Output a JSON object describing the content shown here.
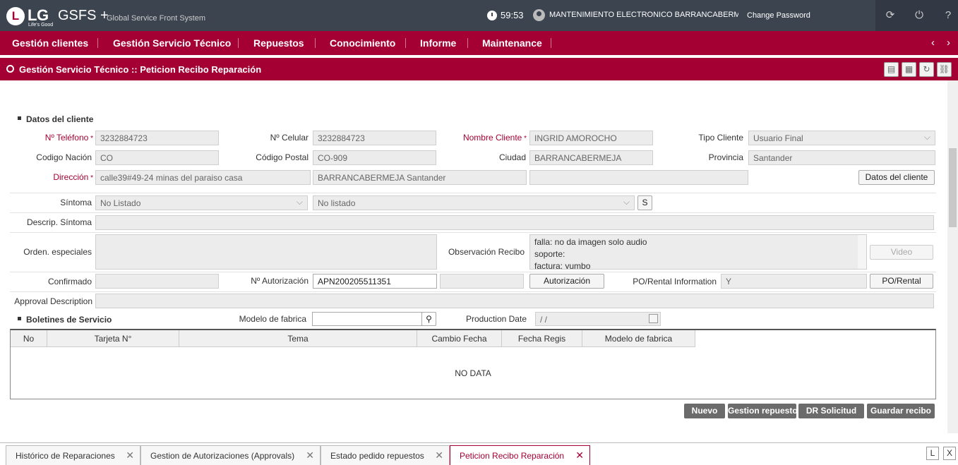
{
  "header": {
    "logo_letters": "LG",
    "logo_text": "LG",
    "logo_tagline": "Life's Good",
    "app_name": "GSFS +",
    "app_subtitle": "Global Service Front System",
    "timer": "59:53",
    "user": "MANTENIMIENTO ELECTRONICO BARRANCABERMEJA",
    "change_password": "Change Password",
    "icons": [
      "refresh-icon",
      "power-icon",
      "help-icon"
    ]
  },
  "menu": {
    "items": [
      "Gestión clientes",
      "Gestión Servicio Técnico",
      "Repuestos",
      "Conocimiento",
      "Informe",
      "Maintenance"
    ]
  },
  "page": {
    "title": "Gestión Servicio Técnico :: Peticion Recibo Reparación",
    "title_icons": [
      "print-icon",
      "excel-icon",
      "reload-icon",
      "link-icon"
    ]
  },
  "cliente": {
    "section_title": "Datos del cliente",
    "telefono_label": "Nº Teléfono",
    "telefono": "3232884723",
    "celular_label": "Nº Celular",
    "celular": "3232884723",
    "nombre_label": "Nombre Cliente",
    "nombre": "INGRID AMOROCHO",
    "tipo_label": "Tipo Cliente",
    "tipo": "Usuario Final",
    "nacion_label": "Codigo Nación",
    "nacion": "CO",
    "postal_label": "Código Postal",
    "postal": "CO-909",
    "ciudad_label": "Ciudad",
    "ciudad": "BARRANCABERMEJA",
    "provincia_label": "Provincia",
    "provincia": "Santander",
    "direccion_label": "Dirección",
    "direccion": "calle39#49-24 minas del paraiso casa",
    "direccion2": "BARRANCABERMEJA  Santander",
    "datos_button": "Datos del cliente"
  },
  "sintoma": {
    "label": "Síntoma",
    "value1": "No Listado",
    "value2": "No listado",
    "s_button": "S",
    "descrip_label": "Descrip. Síntoma",
    "orden_label": "Orden. especiales",
    "obs_label": "Observación Recibo",
    "obs_lines": [
      "falla:  no da imagen solo audio",
      "soporte:",
      "factura: yumbo"
    ],
    "video_button": "Video"
  },
  "autorizacion": {
    "confirmado_label": "Confirmado",
    "aut_label": "Nº Autorización",
    "aut_value": "APN200205511351",
    "aut_button": "Autorización",
    "po_label": "PO/Rental Information",
    "po_value": "Y",
    "po_button": "PO/Rental",
    "approval_label": "Approval Description"
  },
  "boletines": {
    "section_title": "Boletines de Servicio",
    "modelo_label": "Modelo de fabrica",
    "prod_label": "Production Date",
    "prod_value": " /  /",
    "columns": [
      "No",
      "Tarjeta N°",
      "Tema",
      "Cambio Fecha",
      "Fecha Regis",
      "Modelo de fabrica"
    ],
    "empty_text": "NO DATA"
  },
  "actions": [
    "Nuevo",
    "Gestion repuestos",
    "DR Solicitud",
    "Guardar recibo"
  ],
  "tabs": [
    "Histórico de Reparaciones",
    "Gestion de Autorizaciones (Approvals)",
    "Estado pedido repuestos",
    "Peticion Recibo Reparación"
  ],
  "tab_side_buttons": [
    "L",
    "X"
  ],
  "colors": {
    "brand": "#a50034",
    "header_bg": "#3c4450",
    "action_button": "#6b6b6b"
  }
}
